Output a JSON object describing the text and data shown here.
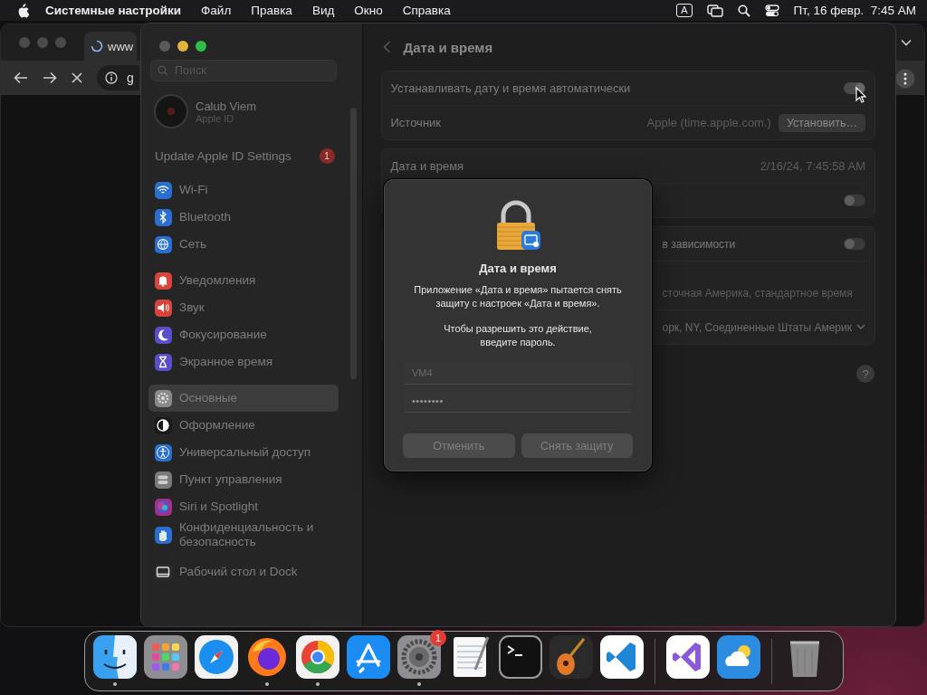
{
  "menubar": {
    "app_name": "Системные настройки",
    "menus": [
      "Файл",
      "Правка",
      "Вид",
      "Окно",
      "Справка"
    ],
    "input_source": "A",
    "clock": "Пт, 16 февр.  7:45 AM"
  },
  "browser": {
    "tab_title": "www",
    "address": "g"
  },
  "settings": {
    "title": "Дата и время",
    "search": {
      "placeholder": "Поиск"
    },
    "account": {
      "name": "Calub Viem",
      "subtitle": "Apple ID"
    },
    "update_notice": {
      "label": "Update Apple ID Settings",
      "badge": "1"
    },
    "sidebar_groups": [
      [
        {
          "label": "Wi-Fi",
          "kind": "wifi",
          "color": "#2a6fd0",
          "selected": false
        },
        {
          "label": "Bluetooth",
          "kind": "bluetooth",
          "color": "#2a6fd0",
          "selected": false
        },
        {
          "label": "Сеть",
          "kind": "globe",
          "color": "#2a6fd0",
          "selected": false
        }
      ],
      [
        {
          "label": "Уведомления",
          "kind": "bell",
          "color": "#d8453c",
          "selected": false
        },
        {
          "label": "Звук",
          "kind": "speaker",
          "color": "#d8453c",
          "selected": false
        },
        {
          "label": "Фокусирование",
          "kind": "moon",
          "color": "#5b4fc9",
          "selected": false
        },
        {
          "label": "Экранное время",
          "kind": "hourglass",
          "color": "#5b4fc9",
          "selected": false
        }
      ],
      [
        {
          "label": "Основные",
          "kind": "gear",
          "color": "#8a8a8a",
          "selected": true
        },
        {
          "label": "Оформление",
          "kind": "contrast",
          "color": "#1a1a1a",
          "selected": false
        },
        {
          "label": "Универсальный доступ",
          "kind": "person",
          "color": "#2a6fd0",
          "selected": false
        },
        {
          "label": "Пункт управления",
          "kind": "switches",
          "color": "#7a7a7a",
          "selected": false
        },
        {
          "label": "Siri и Spotlight",
          "kind": "orb",
          "color": "#a0308a",
          "selected": false
        },
        {
          "label": "Конфиденциальность и безопасность",
          "kind": "hand",
          "color": "#2a6fd0",
          "selected": false
        }
      ],
      [
        {
          "label": "Рабочий стол и Dock",
          "kind": "display",
          "color": "#2b2b2b",
          "selected": false
        }
      ]
    ],
    "auto_time": {
      "label": "Устанавливать дату и время автоматически",
      "on": true
    },
    "source": {
      "label": "Источник",
      "value": "Apple (time.apple.com.)",
      "button": "Установить…"
    },
    "date_time": {
      "label": "Дата и время",
      "value": "2/16/24, 7:45:58 AM"
    },
    "card_2_toggle": {
      "on": false
    },
    "timezone": {
      "auto_label": "в зависимости",
      "auto_on": false,
      "zone": "сточная Америка, стандартное время",
      "city": "орк, NY, Соединенные Штаты Америк"
    },
    "help": "?"
  },
  "dialog": {
    "title": "Дата и время",
    "message": "Приложение «Дата и время» пытается снять защиту с настроек «Дата и время».",
    "prompt": "Чтобы разрешить это действие, введите пароль.",
    "username": "VM4",
    "password": "••••••••",
    "buttons": [
      "Отменить",
      "Снять защиту"
    ]
  },
  "dock": {
    "apps": [
      {
        "kind": "finder",
        "running": true
      },
      {
        "kind": "launchpad",
        "running": false
      },
      {
        "kind": "safari",
        "running": false
      },
      {
        "kind": "firefox",
        "running": true
      },
      {
        "kind": "chrome",
        "running": true
      },
      {
        "kind": "appstore",
        "running": false
      },
      {
        "kind": "settings",
        "running": true,
        "badge": "1"
      },
      {
        "kind": "textedit",
        "running": false
      },
      {
        "kind": "terminal",
        "running": false
      },
      {
        "kind": "garageband",
        "running": false
      },
      {
        "kind": "vscode",
        "running": false
      },
      {
        "kind": "separator"
      },
      {
        "kind": "visualstudio",
        "running": false
      },
      {
        "kind": "weather",
        "running": false
      },
      {
        "kind": "separator"
      },
      {
        "kind": "trash",
        "running": false
      }
    ]
  }
}
